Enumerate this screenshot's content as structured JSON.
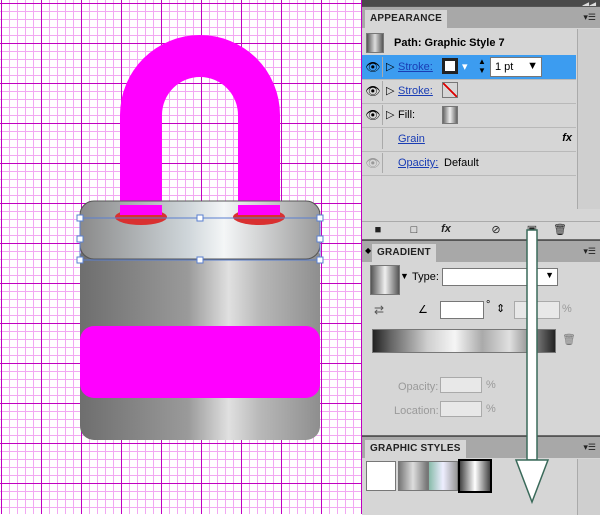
{
  "colors": {
    "magenta": "#ff00ff",
    "grid_major": "#c000c0",
    "grid_minor": "#f2a8f2",
    "selection": "#3c9cf0"
  },
  "appearance": {
    "tab_label": "APPEARANCE",
    "target_label": "Path: Graphic Style 7",
    "rows": [
      {
        "label": "Stroke:",
        "weight": "1 pt"
      },
      {
        "label": "Stroke:"
      },
      {
        "label": "Fill:"
      },
      {
        "label": "Grain",
        "fx": "fx"
      },
      {
        "label": "Opacity:",
        "value": "Default"
      }
    ],
    "toolbar_icons": [
      "new-stroke-icon",
      "new-fill-icon",
      "add-effect-icon",
      "clear-icon",
      "duplicate-icon",
      "trash-icon"
    ],
    "fx_label": "fx"
  },
  "gradient": {
    "tab_label": "GRADIENT",
    "type_label": "Type:",
    "type_value": "",
    "angle_value": "",
    "aspect_value": "",
    "percent_sign": "%",
    "degree_sign": "°",
    "opacity_label": "Opacity:",
    "location_label": "Location:"
  },
  "graphic_styles": {
    "tab_label": "GRAPHIC STYLES",
    "swatches": [
      "default-style",
      "gradient-style-1",
      "gradient-style-2",
      "gradient-style-3"
    ]
  }
}
